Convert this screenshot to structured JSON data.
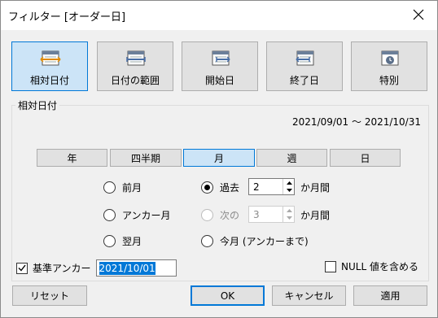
{
  "dialog": {
    "title": "フィルター [オーダー日]",
    "close_icon": "close-icon"
  },
  "modes": [
    {
      "label": "相対日付",
      "icon": "relative-date-icon",
      "active": true
    },
    {
      "label": "日付の範囲",
      "icon": "date-range-icon",
      "active": false
    },
    {
      "label": "開始日",
      "icon": "start-date-icon",
      "active": false
    },
    {
      "label": "終了日",
      "icon": "end-date-icon",
      "active": false
    },
    {
      "label": "特別",
      "icon": "special-icon",
      "active": false
    }
  ],
  "relative": {
    "group_label": "相対日付",
    "date_range": "2021/09/01 ～ 2021/10/31",
    "units": [
      {
        "label": "年",
        "active": false
      },
      {
        "label": "四半期",
        "active": false
      },
      {
        "label": "月",
        "active": true
      },
      {
        "label": "週",
        "active": false
      },
      {
        "label": "日",
        "active": false
      }
    ],
    "options_left": [
      {
        "label": "前月",
        "checked": false
      },
      {
        "label": "アンカー月",
        "checked": false
      },
      {
        "label": "翌月",
        "checked": false
      }
    ],
    "past": {
      "label": "過去",
      "value": "2",
      "suffix": "か月間",
      "checked": true
    },
    "next": {
      "label": "次の",
      "value": "3",
      "suffix": "か月間",
      "checked": false
    },
    "current": {
      "label": "今月 (アンカーまで)",
      "checked": false
    }
  },
  "anchor": {
    "label": "基準アンカー",
    "checked": true,
    "value": "2021/10/01"
  },
  "null_option": {
    "label": "NULL 値を含める",
    "checked": false
  },
  "buttons": {
    "reset": "リセット",
    "ok": "OK",
    "cancel": "キャンセル",
    "apply": "適用"
  },
  "colors": {
    "accent": "#0078d7",
    "active_bg": "#cce4f7",
    "button_bg": "#e1e1e1"
  }
}
